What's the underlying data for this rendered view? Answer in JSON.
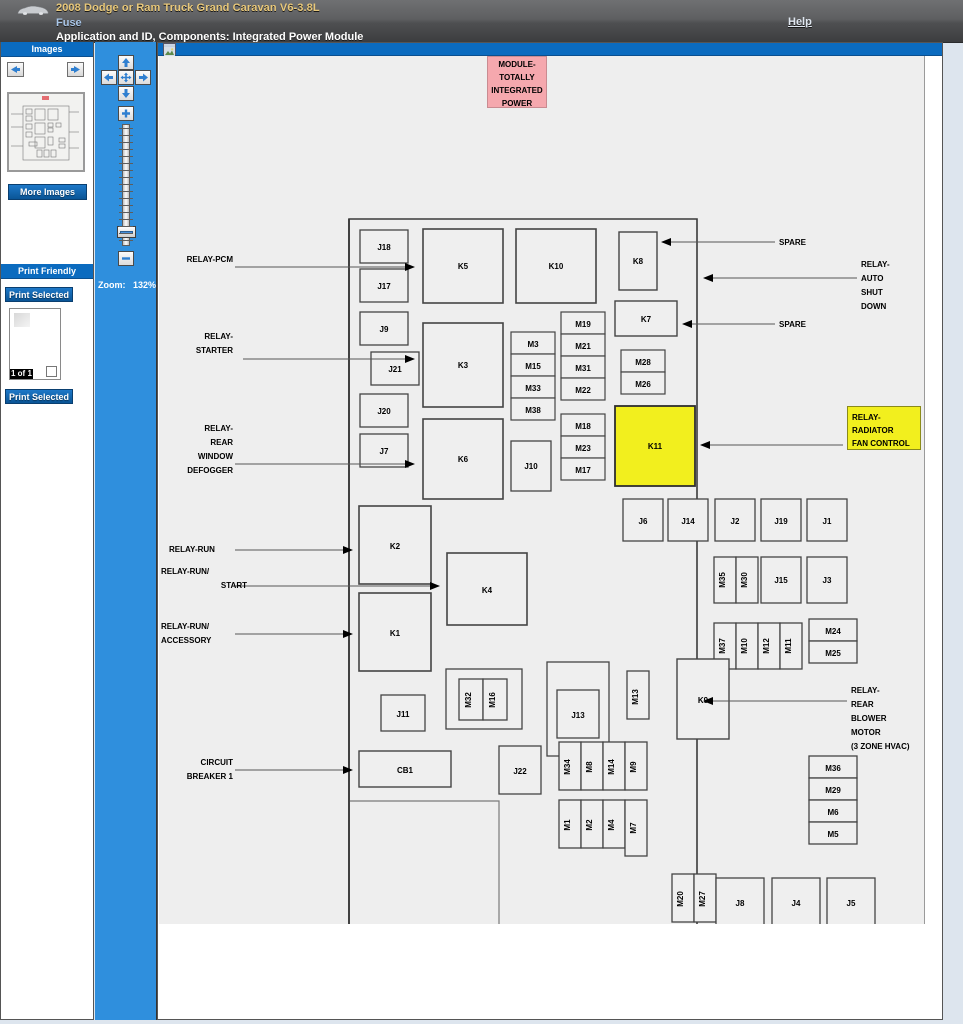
{
  "header": {
    "vehicle_title": "2008 Dodge or Ram Truck Grand Caravan V6-3.8L",
    "category": "Fuse",
    "subtitle": "Application and ID, Components: Integrated Power Module",
    "help_label": "Help",
    "vehicle_icon": "car-icon"
  },
  "sidebar": {
    "images_panel_title": "Images",
    "prev_icon": "arrow-left-icon",
    "next_icon": "arrow-right-icon",
    "more_images_label": "More Images",
    "print_friendly_title": "Print Friendly",
    "print_selected_top_label": "Print Selected",
    "print_selected_bottom_label": "Print Selected",
    "page_count": "1 of 1"
  },
  "zoom_panel": {
    "pan_up_icon": "arrow-up-icon",
    "pan_down_icon": "arrow-down-icon",
    "pan_left_icon": "arrow-left-icon",
    "pan_right_icon": "arrow-right-icon",
    "pan_center_icon": "move-icon",
    "zoom_in_icon": "plus-icon",
    "zoom_out_icon": "minus-icon",
    "zoom_label": "Zoom:",
    "zoom_value": "132%"
  },
  "viewer": {
    "toolbar_icon": "image-thumbnail-icon"
  },
  "diagram": {
    "title_callout": {
      "text": "MODULE- TOTALLY INTEGRATED POWER",
      "lines": [
        "MODULE-",
        "TOTALLY",
        "INTEGRATED",
        "POWER"
      ],
      "fill": "#f5a8ae"
    },
    "highlight_callout": {
      "lines": [
        "RELAY-",
        "RADIATOR",
        "FAN CONTROL"
      ],
      "fill": "#f2ef1e",
      "target": "K11"
    },
    "highlighted_component": "K11",
    "left_labels": [
      {
        "lines": [
          "RELAY-PCM"
        ],
        "target": "K5"
      },
      {
        "lines": [
          "RELAY-",
          "STARTER"
        ],
        "target": "K3"
      },
      {
        "lines": [
          "RELAY-",
          "REAR",
          "WINDOW",
          "DEFOGGER"
        ],
        "target": "K6"
      },
      {
        "lines": [
          "RELAY-RUN"
        ],
        "target": "K2"
      },
      {
        "lines": [
          "RELAY-RUN/",
          "START"
        ],
        "target": "K4"
      },
      {
        "lines": [
          "RELAY-RUN/",
          "ACCESSORY"
        ],
        "target": "K1"
      },
      {
        "lines": [
          "CIRCUIT",
          "BREAKER 1"
        ],
        "target": "CB1"
      }
    ],
    "right_labels": [
      {
        "lines": [
          "SPARE"
        ],
        "target": "K8"
      },
      {
        "lines": [
          "RELAY-",
          "AUTO",
          "SHUT",
          "DOWN"
        ],
        "target": "K8"
      },
      {
        "lines": [
          "SPARE"
        ],
        "target": "K7"
      },
      {
        "lines": [
          "RELAY-",
          "REAR",
          "BLOWER",
          "MOTOR",
          "(3 ZONE HVAC)"
        ],
        "target": "K9"
      }
    ],
    "components": {
      "relays": [
        "K1",
        "K2",
        "K3",
        "K4",
        "K5",
        "K6",
        "K7",
        "K8",
        "K9",
        "K10",
        "K11"
      ],
      "circuit_breakers": [
        "CB1"
      ],
      "connectors": [
        "J1",
        "J2",
        "J3",
        "J4",
        "J5",
        "J6",
        "J7",
        "J8",
        "J9",
        "J10",
        "J11",
        "J13",
        "J14",
        "J15",
        "J17",
        "J18",
        "J19",
        "J20",
        "J21",
        "J22"
      ],
      "fuses": [
        "M1",
        "M2",
        "M3",
        "M4",
        "M5",
        "M6",
        "M7",
        "M8",
        "M9",
        "M10",
        "M11",
        "M12",
        "M13",
        "M14",
        "M15",
        "M16",
        "M17",
        "M18",
        "M19",
        "M20",
        "M21",
        "M22",
        "M23",
        "M24",
        "M25",
        "M26",
        "M27",
        "M28",
        "M29",
        "M30",
        "M31",
        "M32",
        "M33",
        "M34",
        "M35",
        "M36",
        "M37",
        "M38"
      ]
    }
  },
  "colors": {
    "accent_blue": "#0b6bbf",
    "panel_blue": "#2f8fdd",
    "highlight_yellow": "#f2ef1e",
    "callout_pink": "#f5a8ae",
    "page_bg": "#dde5ee",
    "canvas_bg": "#eeeeee"
  }
}
